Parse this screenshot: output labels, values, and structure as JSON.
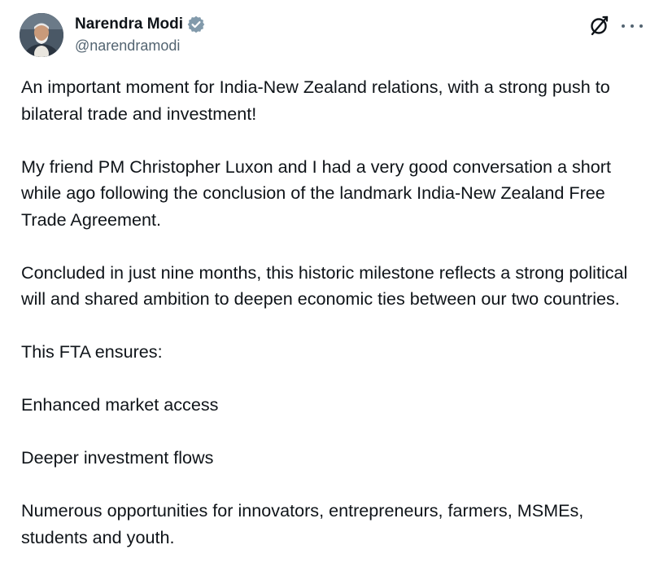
{
  "author": {
    "display_name": "Narendra Modi",
    "handle": "@narendramodi",
    "verified": true
  },
  "icons": {
    "verified": "verified-badge-icon",
    "grok": "grok-icon",
    "more": "more-options-icon"
  },
  "colors": {
    "text": "#0f1419",
    "secondary": "#536471",
    "verified_badge": "#829aab"
  },
  "tweet": {
    "paragraphs": [
      "An important moment for India-New Zealand relations, with a strong push to bilateral trade and investment!",
      "My friend PM Christopher Luxon and I had a very good conversation a short while ago following the conclusion of the landmark India-New Zealand Free Trade Agreement.",
      "Concluded in just nine months, this historic milestone reflects a strong political will and shared ambition to deepen economic ties between our two countries.",
      "This FTA ensures:",
      "Enhanced market access",
      "Deeper investment flows",
      "Numerous opportunities for innovators, entrepreneurs, farmers, MSMEs, students and youth."
    ]
  }
}
